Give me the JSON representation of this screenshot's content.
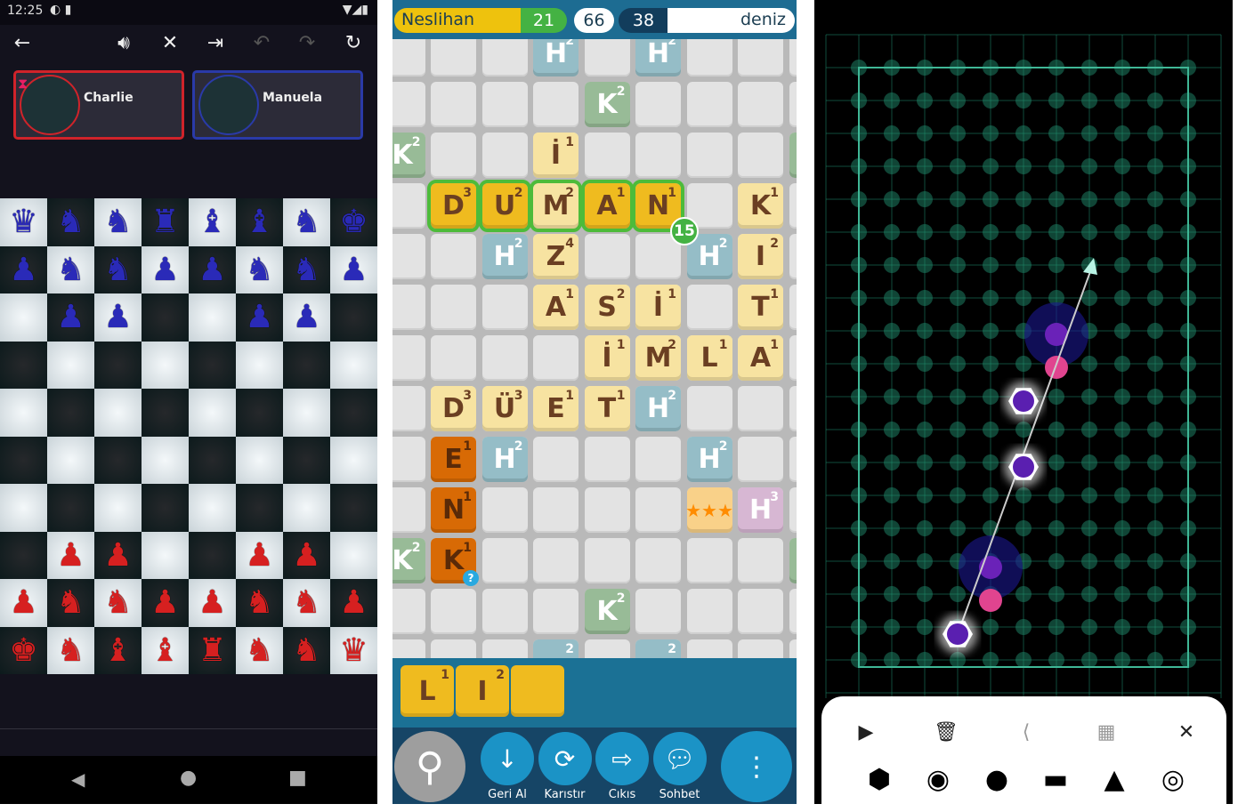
{
  "chess_app": {
    "status_bar": {
      "time": "12:25"
    },
    "toolbar": {
      "icons": [
        "back-arrow-icon",
        "volume-icon",
        "close-icon",
        "exit-icon",
        "undo-icon",
        "redo-icon",
        "refresh-icon"
      ]
    },
    "players": [
      {
        "name": "Charlie",
        "border": "#d0232a"
      },
      {
        "name": "Manuela",
        "border": "#2a3aa8"
      }
    ],
    "colors": {
      "blue": "#2a2ab8",
      "red": "#d62020"
    },
    "board": [
      [
        "bQ",
        "bW",
        "bF",
        "bR",
        "bB",
        "bB",
        "bN",
        "bK"
      ],
      [
        "bP",
        "bS",
        "bS",
        "bP",
        "bP",
        "bS",
        "bS",
        "bP"
      ],
      [
        "",
        "bP",
        "bP",
        "",
        "",
        "bP",
        "bP",
        ""
      ],
      [
        "",
        "",
        "",
        "",
        "",
        "",
        "",
        ""
      ],
      [
        "",
        "",
        "",
        "",
        "",
        "",
        "",
        ""
      ],
      [
        "",
        "",
        "",
        "",
        "",
        "",
        "",
        ""
      ],
      [
        "",
        "",
        "",
        "",
        "",
        "",
        "",
        ""
      ],
      [
        "",
        "rP",
        "rP",
        "",
        "",
        "rP",
        "rP",
        ""
      ],
      [
        "rP",
        "rS",
        "rS",
        "rP",
        "rP",
        "rS",
        "rS",
        "rP"
      ],
      [
        "rK",
        "rN",
        "rB",
        "rB",
        "rR",
        "rF",
        "rW",
        "rQ"
      ]
    ]
  },
  "word_game": {
    "header": {
      "player1": "Neslihan",
      "score1": "21",
      "remaining": "66",
      "score2": "38",
      "player2": "deniz"
    },
    "tiles": [
      {
        "c": 3,
        "r": 0,
        "l": "H",
        "v": "2",
        "t": "H"
      },
      {
        "c": 5,
        "r": 0,
        "l": "H",
        "v": "2",
        "t": "H"
      },
      {
        "c": 4,
        "r": 1,
        "l": "K",
        "v": "2",
        "t": "K"
      },
      {
        "c": 0,
        "r": 2,
        "l": "K",
        "v": "2",
        "t": "K"
      },
      {
        "c": 3,
        "r": 2,
        "l": "İ",
        "v": "1",
        "t": "light"
      },
      {
        "c": 8,
        "r": 2,
        "l": "",
        "v": "",
        "t": "K"
      },
      {
        "c": 1,
        "r": 3,
        "l": "D",
        "v": "3",
        "t": "gold",
        "hl": true
      },
      {
        "c": 2,
        "r": 3,
        "l": "U",
        "v": "2",
        "t": "gold",
        "hl": true
      },
      {
        "c": 3,
        "r": 3,
        "l": "M",
        "v": "2",
        "t": "light",
        "hl": true
      },
      {
        "c": 4,
        "r": 3,
        "l": "A",
        "v": "1",
        "t": "gold",
        "hl": true
      },
      {
        "c": 5,
        "r": 3,
        "l": "N",
        "v": "1",
        "t": "gold",
        "hl": true
      },
      {
        "c": 7,
        "r": 3,
        "l": "K",
        "v": "1",
        "t": "light"
      },
      {
        "c": 2,
        "r": 4,
        "l": "H",
        "v": "2",
        "t": "H"
      },
      {
        "c": 3,
        "r": 4,
        "l": "Z",
        "v": "4",
        "t": "light"
      },
      {
        "c": 6,
        "r": 4,
        "l": "H",
        "v": "2",
        "t": "H"
      },
      {
        "c": 7,
        "r": 4,
        "l": "I",
        "v": "2",
        "t": "light"
      },
      {
        "c": 3,
        "r": 5,
        "l": "A",
        "v": "1",
        "t": "light"
      },
      {
        "c": 4,
        "r": 5,
        "l": "S",
        "v": "2",
        "t": "light"
      },
      {
        "c": 5,
        "r": 5,
        "l": "İ",
        "v": "1",
        "t": "light"
      },
      {
        "c": 7,
        "r": 5,
        "l": "T",
        "v": "1",
        "t": "light"
      },
      {
        "c": 4,
        "r": 6,
        "l": "İ",
        "v": "1",
        "t": "light"
      },
      {
        "c": 5,
        "r": 6,
        "l": "M",
        "v": "2",
        "t": "light"
      },
      {
        "c": 6,
        "r": 6,
        "l": "L",
        "v": "1",
        "t": "light"
      },
      {
        "c": 7,
        "r": 6,
        "l": "A",
        "v": "1",
        "t": "light"
      },
      {
        "c": 1,
        "r": 7,
        "l": "D",
        "v": "3",
        "t": "light"
      },
      {
        "c": 2,
        "r": 7,
        "l": "Ü",
        "v": "3",
        "t": "light"
      },
      {
        "c": 3,
        "r": 7,
        "l": "E",
        "v": "1",
        "t": "light"
      },
      {
        "c": 4,
        "r": 7,
        "l": "T",
        "v": "1",
        "t": "light"
      },
      {
        "c": 5,
        "r": 7,
        "l": "H",
        "v": "2",
        "t": "H"
      },
      {
        "c": 1,
        "r": 8,
        "l": "E",
        "v": "1",
        "t": "orange"
      },
      {
        "c": 2,
        "r": 8,
        "l": "H",
        "v": "2",
        "t": "H"
      },
      {
        "c": 6,
        "r": 8,
        "l": "H",
        "v": "2",
        "t": "H"
      },
      {
        "c": 1,
        "r": 9,
        "l": "N",
        "v": "1",
        "t": "orange"
      },
      {
        "c": 6,
        "r": 9,
        "l": "★★★",
        "v": "",
        "t": "star"
      },
      {
        "c": 7,
        "r": 9,
        "l": "H",
        "v": "3",
        "t": "H3"
      },
      {
        "c": 0,
        "r": 10,
        "l": "K",
        "v": "2",
        "t": "K"
      },
      {
        "c": 1,
        "r": 10,
        "l": "K",
        "v": "1",
        "t": "orange",
        "q": true
      },
      {
        "c": 8,
        "r": 10,
        "l": "",
        "v": "",
        "t": "K"
      },
      {
        "c": 4,
        "r": 11,
        "l": "K",
        "v": "2",
        "t": "K"
      },
      {
        "c": 3,
        "r": 12,
        "l": "",
        "v": "2",
        "t": "H"
      },
      {
        "c": 5,
        "r": 12,
        "l": "",
        "v": "2",
        "t": "H"
      }
    ],
    "word_score": "15",
    "rack": [
      {
        "l": "L",
        "v": "1"
      },
      {
        "l": "I",
        "v": "2"
      },
      {
        "l": "",
        "v": ""
      }
    ],
    "buttons": [
      {
        "label": "Geri Al",
        "icon": "arrow-down-icon"
      },
      {
        "label": "Karıstır",
        "icon": "shuffle-icon"
      },
      {
        "label": "Cıkıs",
        "icon": "exit-icon"
      },
      {
        "label": "Sohbet",
        "icon": "chat-icon"
      }
    ]
  },
  "grid_app": {
    "colors": {
      "grid": "#1f8a6c",
      "node": "#5a1fb0",
      "pink": "#e0448f"
    },
    "toolbar_icons": [
      "play-icon",
      "trash-icon",
      "share-icon",
      "qr-code-icon",
      "close-icon"
    ],
    "shapes": [
      "hexagon-icon",
      "target-circle-icon",
      "circle-icon",
      "bar-icon",
      "triangle-icon",
      "ring-icon"
    ]
  }
}
